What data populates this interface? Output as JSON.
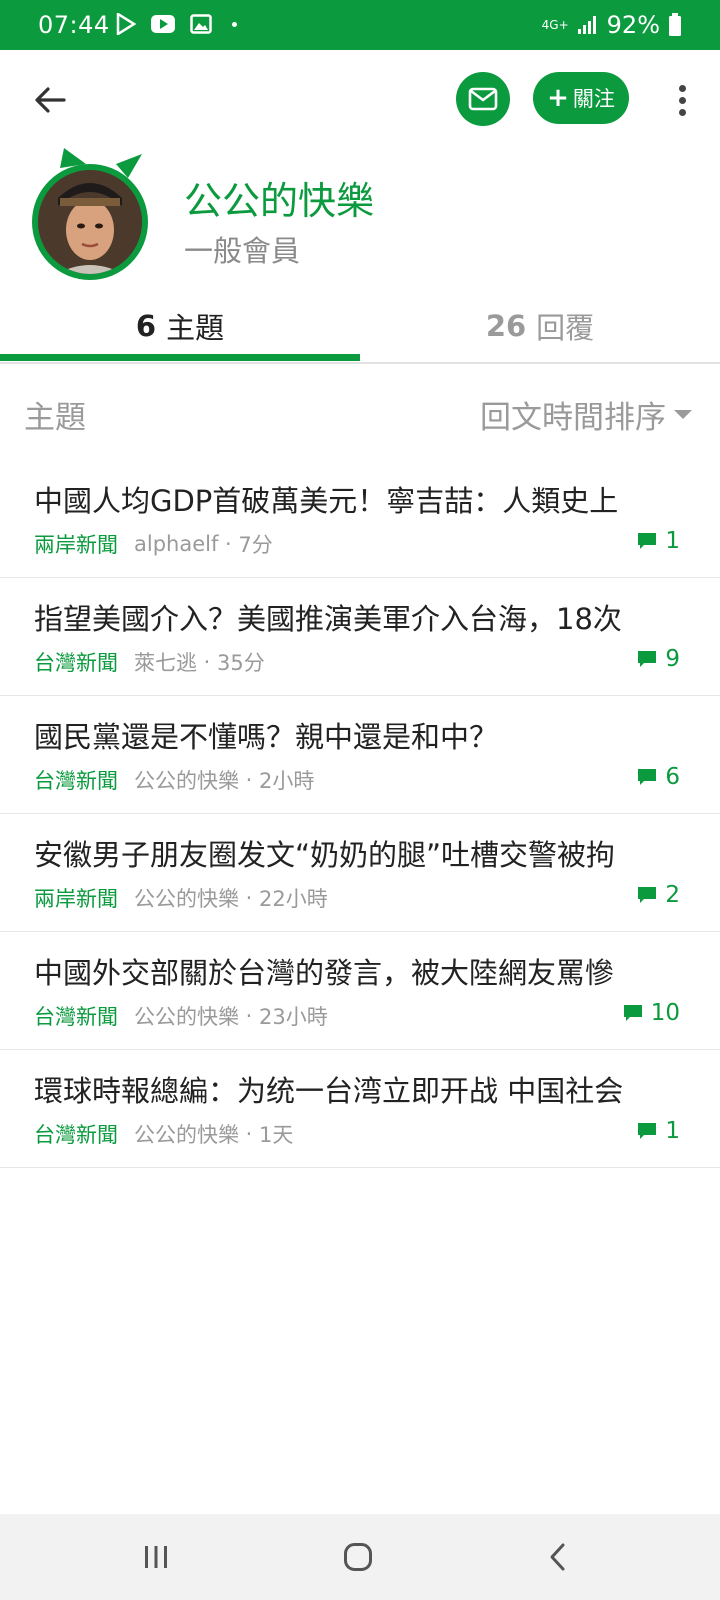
{
  "status_bar": {
    "time": "07:44",
    "network": "4G+",
    "battery": "92%",
    "left_icons": [
      "play-store-icon",
      "youtube-icon",
      "gallery-icon"
    ]
  },
  "header": {
    "follow_label": "關注"
  },
  "profile": {
    "name": "公公的快樂",
    "role": "一般會員"
  },
  "tabs": [
    {
      "count": "6",
      "label": "主題"
    },
    {
      "count": "26",
      "label": "回覆"
    }
  ],
  "filter": {
    "label": "主題",
    "sort_label": "回文時間排序"
  },
  "topics": [
    {
      "title": "中國人均GDP首破萬美元！寧吉喆：人類史上",
      "category": "兩岸新聞",
      "author": "alphaelf",
      "time": "7分",
      "replies": "1"
    },
    {
      "title": "指望美國介入？美國推演美軍介入台海，18次",
      "category": "台灣新聞",
      "author": "萊七逃",
      "time": "35分",
      "replies": "9"
    },
    {
      "title": "國民黨還是不懂嗎？親中還是和中？",
      "category": "台灣新聞",
      "author": "公公的快樂",
      "time": "2小時",
      "replies": "6"
    },
    {
      "title": "安徽男子朋友圈发文“奶奶的腿”吐槽交警被拘",
      "category": "兩岸新聞",
      "author": "公公的快樂",
      "time": "22小時",
      "replies": "2"
    },
    {
      "title": "中國外交部關於台灣的發言，被大陸網友罵慘",
      "category": "台灣新聞",
      "author": "公公的快樂",
      "time": "23小時",
      "replies": "10"
    },
    {
      "title": "環球時報總編：为统一台湾立即开战 中国社会",
      "category": "台灣新聞",
      "author": "公公的快樂",
      "time": "1天",
      "replies": "1"
    }
  ],
  "colors": {
    "accent": "#0b9a3e",
    "muted_text": "#9a9a9a"
  }
}
